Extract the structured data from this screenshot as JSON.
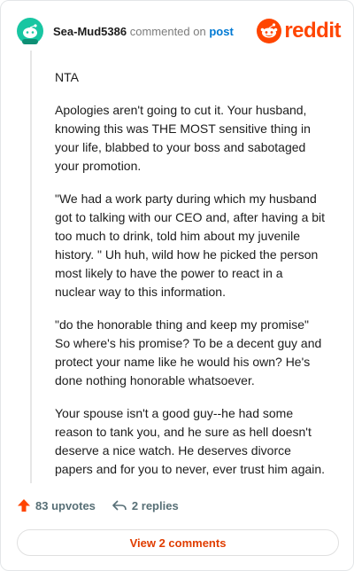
{
  "comment": {
    "username": "Sea-Mud5386",
    "commented_on_text": "commented on",
    "post_link_text": "post",
    "paragraphs": [
      "NTA",
      "Apologies aren't going to cut it. Your husband, knowing this was THE MOST sensitive thing in your life, blabbed to your boss and sabotaged your promotion.",
      "\"We had a work party during which my husband got to talking with our CEO and, after having a bit too much to drink, told him about my juvenile history. \" Uh huh, wild how he picked the person most likely to have the power to react in a nuclear way to this information.",
      "\"do the honorable thing and keep my promise\" So where's his promise? To be a decent guy and protect your name like he would his own? He's done nothing honorable whatsoever.",
      "Your spouse isn't a good guy--he had some reason to tank you, and he sure as hell doesn't deserve a nice watch. He deserves divorce papers and for you to never, ever trust him again."
    ]
  },
  "brand": {
    "logo_text": "reddit",
    "logo_color": "#ff4500"
  },
  "actions": {
    "upvotes_label": "83 upvotes",
    "replies_label": "2 replies",
    "view_comments_label": "View 2 comments"
  },
  "icons": {
    "avatar": "snoo-avatar-icon",
    "logo": "reddit-logo-icon",
    "upvote": "upvote-arrow-icon",
    "reply": "reply-arrow-icon"
  },
  "colors": {
    "accent": "#ff4500",
    "link": "#0079d3",
    "avatar_bg": "#18c6a2"
  }
}
